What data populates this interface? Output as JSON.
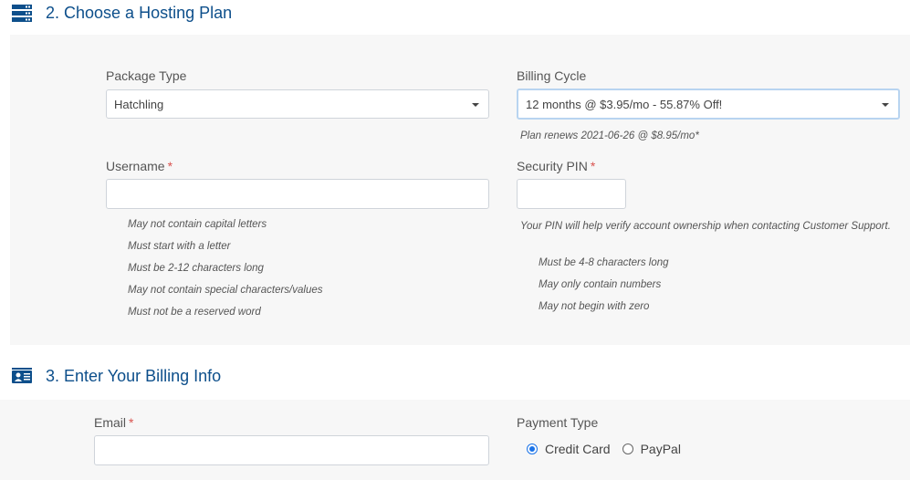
{
  "section2": {
    "title": "2. Choose a Hosting Plan",
    "icon": "server-icon",
    "package_type": {
      "label": "Package Type",
      "value": "Hatchling"
    },
    "billing_cycle": {
      "label": "Billing Cycle",
      "value": "12 months @ $3.95/mo - 55.87% Off!",
      "note": "Plan renews 2021-06-26 @ $8.95/mo*"
    },
    "username": {
      "label": "Username",
      "required": "*",
      "value": "",
      "rules": [
        "May not contain capital letters",
        "Must start with a letter",
        "Must be 2-12 characters long",
        "May not contain special characters/values",
        "Must not be a reserved word"
      ]
    },
    "security_pin": {
      "label": "Security PIN",
      "required": "*",
      "value": "",
      "description": "Your PIN will help verify account ownership when contacting Customer Support.",
      "rules": [
        "Must be 4-8 characters long",
        "May only contain numbers",
        "May not begin with zero"
      ]
    }
  },
  "section3": {
    "title": "3. Enter Your Billing Info",
    "icon": "id-card-icon",
    "email": {
      "label": "Email",
      "required": "*",
      "value": ""
    },
    "payment_type": {
      "label": "Payment Type",
      "options": [
        {
          "label": "Credit Card",
          "selected": true
        },
        {
          "label": "PayPal",
          "selected": false
        }
      ]
    }
  },
  "colors": {
    "heading": "#0d4f8b",
    "required": "#d9534f",
    "radio_accent": "#1a73e8",
    "panel_bg": "#f7f7f7"
  }
}
